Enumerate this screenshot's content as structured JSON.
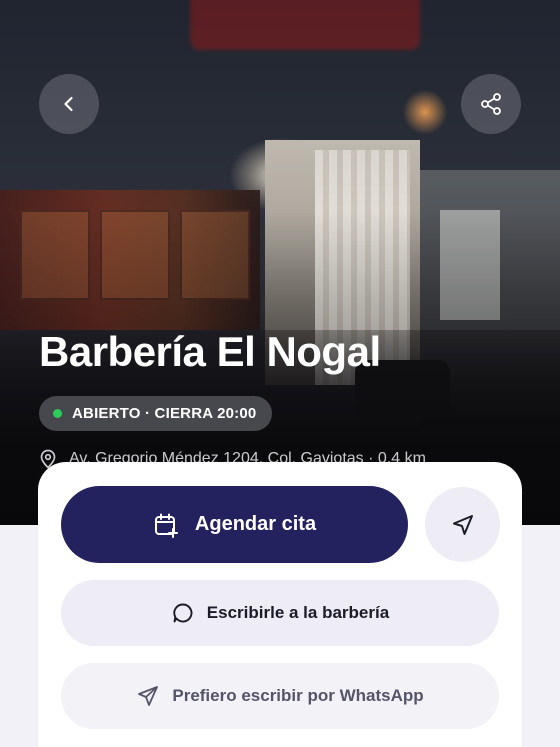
{
  "header": {
    "back_icon": "chevron-left-icon",
    "share_icon": "share-icon"
  },
  "shop": {
    "name": "Barbería El Nogal",
    "status": "ABIERTO · CIERRA 20:00",
    "status_color": "#2ecc5a",
    "address": "Av. Gregorio Méndez 1204, Col. Gaviotas · 0.4 km"
  },
  "actions": {
    "book_label": "Agendar cita",
    "book_icon": "calendar-plus-icon",
    "navigate_icon": "navigation-arrow-icon",
    "message_label": "Escribirle a la barbería",
    "message_icon": "chat-bubble-icon",
    "whatsapp_label": "Prefiero escribir por WhatsApp",
    "whatsapp_icon": "send-icon"
  },
  "colors": {
    "primary": "#24215f",
    "secondary_bg": "#eeedf5"
  }
}
